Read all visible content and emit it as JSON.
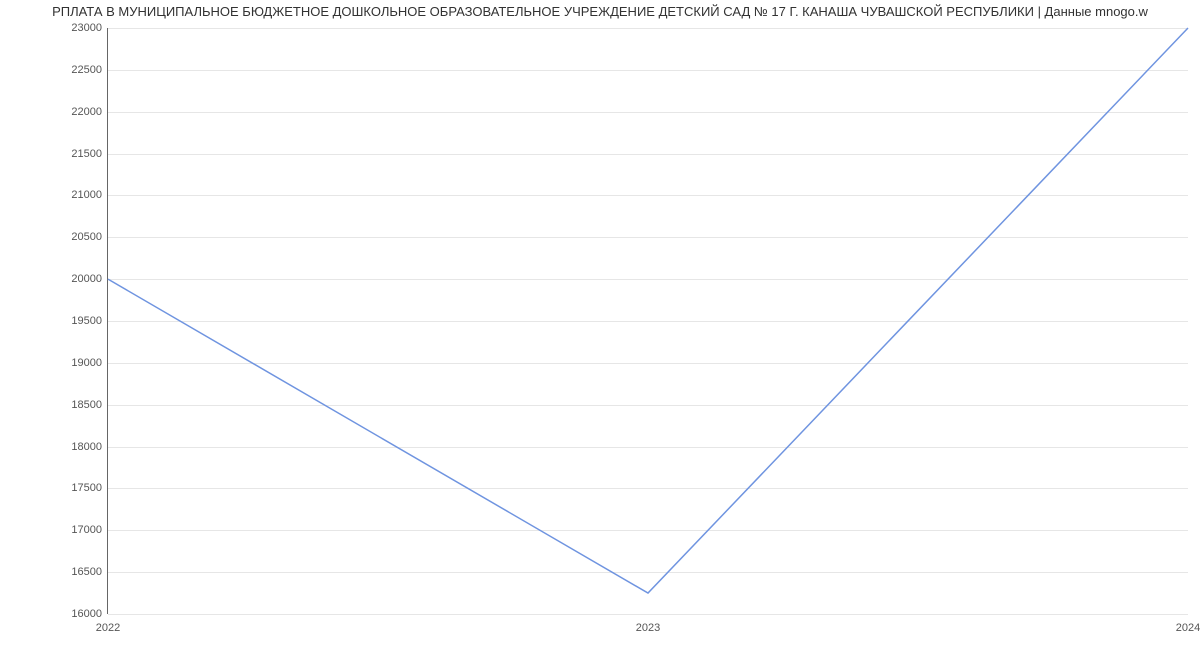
{
  "chart_data": {
    "type": "line",
    "title": "РПЛАТА В МУНИЦИПАЛЬНОЕ БЮДЖЕТНОЕ ДОШКОЛЬНОЕ ОБРАЗОВАТЕЛЬНОЕ УЧРЕЖДЕНИЕ ДЕТСКИЙ САД № 17 Г. КАНАША ЧУВАШСКОЙ РЕСПУБЛИКИ | Данные mnogo.w",
    "x": [
      "2022",
      "2023",
      "2024"
    ],
    "values": [
      20000,
      16250,
      23000
    ],
    "xlabel": "",
    "ylabel": "",
    "ylim": [
      16000,
      23000
    ],
    "y_ticks": [
      16000,
      16500,
      17000,
      17500,
      18000,
      18500,
      19000,
      19500,
      20000,
      20500,
      21000,
      21500,
      22000,
      22500,
      23000
    ],
    "line_color": "#6f94e0",
    "grid": true
  }
}
